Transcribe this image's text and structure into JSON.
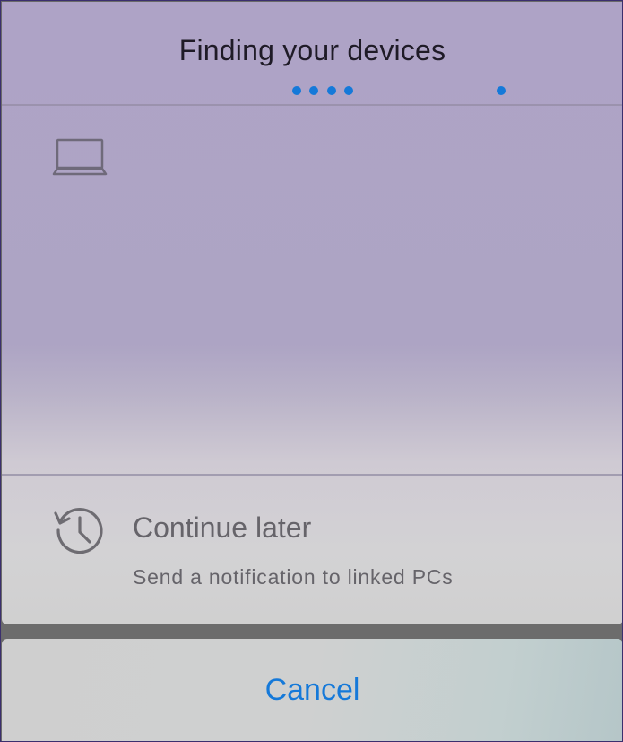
{
  "dialog": {
    "title": "Finding your devices",
    "progress_dots": 5,
    "accent_color": "#1579d9"
  },
  "device_list": {
    "items": [
      {
        "icon": "laptop-icon"
      }
    ]
  },
  "continue_later": {
    "icon": "history-icon",
    "title": "Continue later",
    "subtitle": "Send a notification to linked PCs"
  },
  "cancel": {
    "label": "Cancel"
  }
}
